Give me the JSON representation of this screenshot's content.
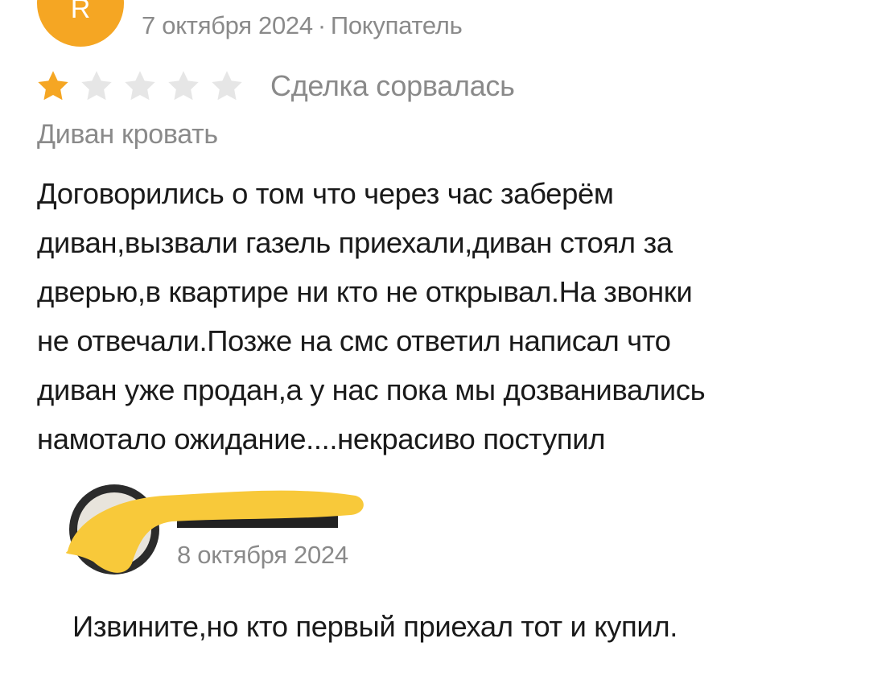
{
  "review": {
    "avatar_letter": "R",
    "avatar_color": "#f5a623",
    "date": "7 октября 2024",
    "separator": "·",
    "author_role": "Покупатель",
    "rating": 1,
    "rating_max": 5,
    "star_filled_color": "#f5a623",
    "star_empty_color": "#e6e6e6",
    "deal_status": "Сделка сорвалась",
    "product_title": "Диван кровать",
    "text_lines": [
      "Договорились о том что через час заберём",
      "диван,вызвали газель приехали,диван стоял за",
      "дверью,в квартире ни кто не открывал.На звонки",
      "не отвечали.Позже на смс ответил написал что",
      "диван уже продан,а у нас пока мы дозванивались",
      "намотало ожидание....некрасиво поступил"
    ]
  },
  "reply": {
    "redaction_color": "#f8c93a",
    "date": "8 октября 2024",
    "text": "Извините,но кто первый приехал тот и купил."
  }
}
